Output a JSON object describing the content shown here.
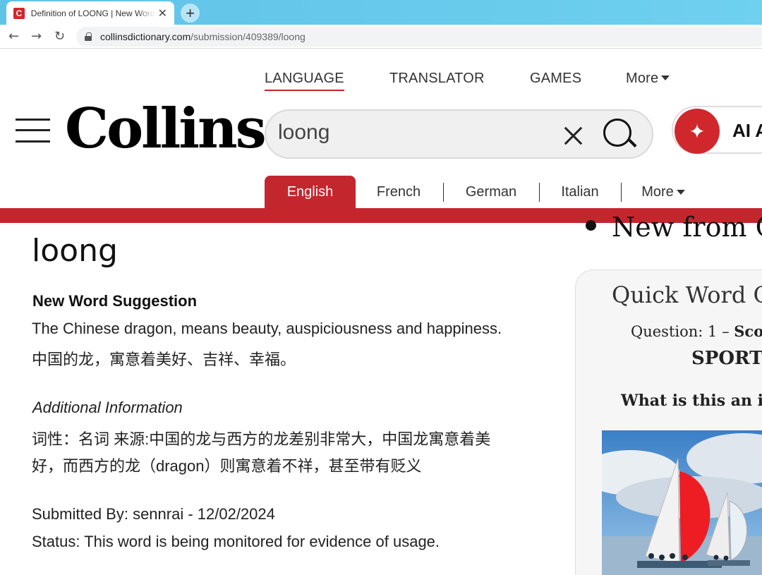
{
  "browser": {
    "tab_title": "Definition of LOONG | New Word Suggestion",
    "tab_favicon": "C",
    "close_glyph": "✕",
    "newtab_glyph": "+",
    "url_domain": "collinsdictionary.com",
    "url_path": "/submission/409389/loong",
    "back_glyph": "←",
    "forward_glyph": "→",
    "reload_glyph": "↻"
  },
  "header": {
    "nav": [
      "LANGUAGE",
      "TRANSLATOR",
      "GAMES",
      "More"
    ],
    "logo": "Collins",
    "search_value": "loong",
    "ai_label": "AI A",
    "ai_glyph": "✦"
  },
  "lang_tabs": [
    "English",
    "French",
    "German",
    "Italian",
    "More"
  ],
  "entry": {
    "word": "loong",
    "heading": "New Word Suggestion",
    "definition_en": "The Chinese dragon, means beauty, auspiciousness and happiness.",
    "definition_zh": "中国的龙，寓意着美好、吉祥、幸福。",
    "additional_heading": "Additional Information",
    "additional_line1": "词性：名词 来源:中国的龙与西方的龙差别非常大，中国龙寓意着美",
    "additional_line2": "好，而西方的龙（dragon）则寓意着不祥，甚至带有贬义",
    "submitted": "Submitted By: sennrai - 12/02/2024",
    "status": "Status: This word is being monitored for evidence of usage."
  },
  "sidebar": {
    "bullet_text": "New from C",
    "quiz_title": "Quick Word C",
    "quiz_question": "Question: 1",
    "quiz_dash": " – ",
    "quiz_score": "Sco",
    "quiz_category": "SPORT",
    "quiz_ask": "What is this an i"
  },
  "colors": {
    "brand_red": "#c4262e",
    "favicon_red": "#d0272d"
  }
}
